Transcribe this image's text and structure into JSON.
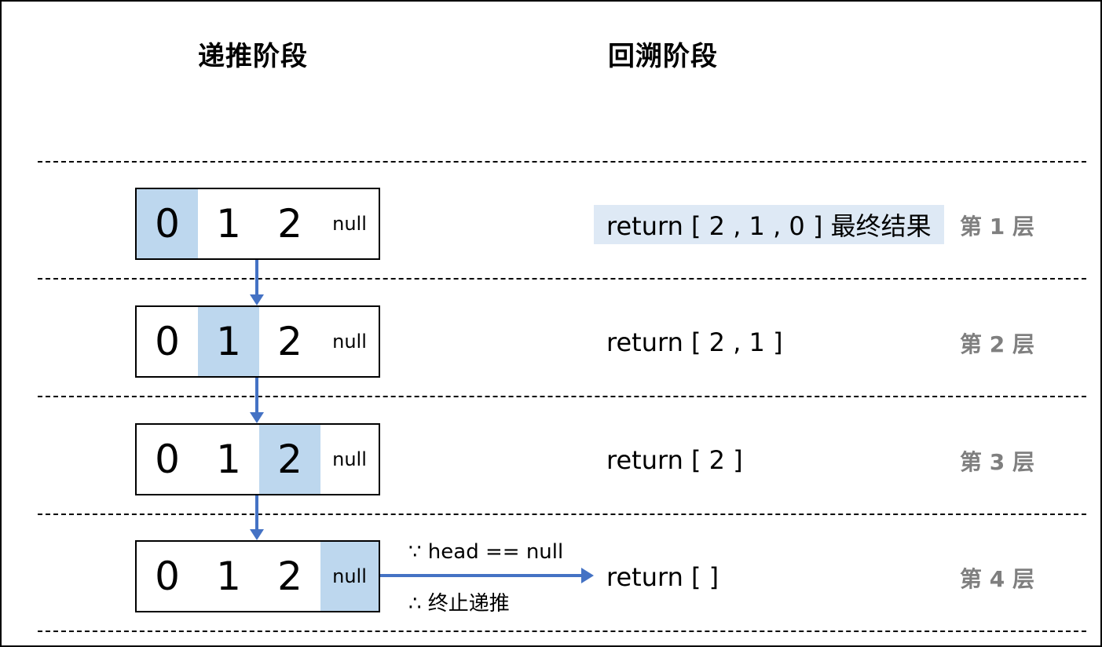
{
  "headings": {
    "recursion": "递推阶段",
    "backtrack": "回溯阶段"
  },
  "list": {
    "values": [
      "0",
      "1",
      "2"
    ],
    "null_label": "null"
  },
  "rows": [
    {
      "highlight_index": 0,
      "return_text": "return [ 2 , 1 , 0 ] 最终结果",
      "return_highlighted": true,
      "level": "第 1 层"
    },
    {
      "highlight_index": 1,
      "return_text": "return [ 2 , 1 ]",
      "return_highlighted": false,
      "level": "第 2 层"
    },
    {
      "highlight_index": 2,
      "return_text": "return [ 2 ]",
      "return_highlighted": false,
      "level": "第 3 层"
    },
    {
      "highlight_index": 3,
      "return_text": "return [ ]",
      "return_highlighted": false,
      "level": "第 4 层"
    }
  ],
  "termination": {
    "because": "∵ head == null",
    "therefore": "∴ 终止递推"
  },
  "colors": {
    "cell_highlight": "#bdd7ee",
    "return_highlight": "#dee9f5",
    "arrow": "#4472c4",
    "level_text": "#7f7f7f"
  }
}
